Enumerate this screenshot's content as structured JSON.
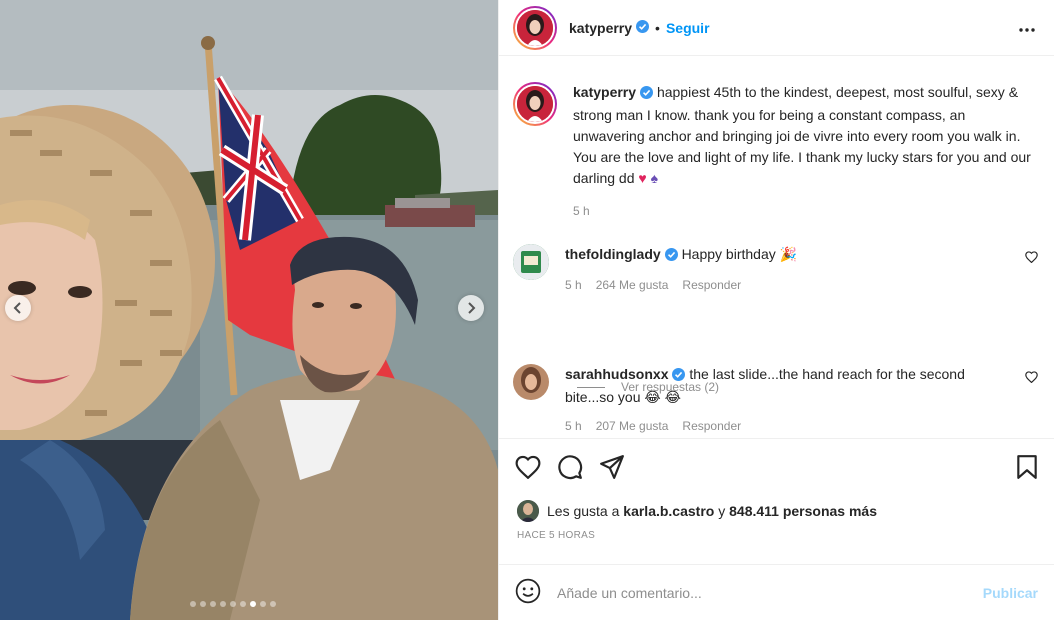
{
  "post": {
    "username": "katyperry",
    "follow_label": "Seguir",
    "separator": "•",
    "caption": {
      "username": "katyperry",
      "text": "happiest 45th to the kindest, deepest, most soulful, sexy & strong man I know. thank you for being a constant compass, an unwavering anchor and bringing joi de vivre into every room you walk in. You are the love and light of my life. I thank my lucky stars for you and our darling dd",
      "emojis": "♥ ♠",
      "time": "5 h"
    },
    "carousel": {
      "total_slides": 9,
      "active_slide": 6
    }
  },
  "comments": [
    {
      "username": "thefoldinglady",
      "text": "Happy birthday",
      "emoji": "🎉",
      "time": "5 h",
      "likes": "264 Me gusta",
      "reply_label": "Responder",
      "view_replies": "Ver respuestas (2)"
    },
    {
      "username": "sarahhudsonxx",
      "text": "the last slide...the hand reach for the second bite...so you",
      "emoji": "😂 😂",
      "time": "5 h",
      "likes": "207 Me gusta",
      "reply_label": "Responder"
    }
  ],
  "likes_line": {
    "prefix": "Les gusta a",
    "user": "karla.b.castro",
    "connector": "y",
    "others": "848.411 personas más"
  },
  "time_ago": "HACE 5 HORAS",
  "composer": {
    "placeholder": "Añade un comentario...",
    "publish_label": "Publicar"
  },
  "icons": {
    "verified": "verified-badge-icon",
    "more": "more-options-icon",
    "like": "heart-icon",
    "comment": "comment-icon",
    "share": "share-icon",
    "save": "bookmark-icon",
    "emoji": "emoji-icon"
  },
  "colors": {
    "link": "#0095f6",
    "verified": "#3897f0",
    "text": "#262626",
    "muted": "#8e8e8e"
  }
}
